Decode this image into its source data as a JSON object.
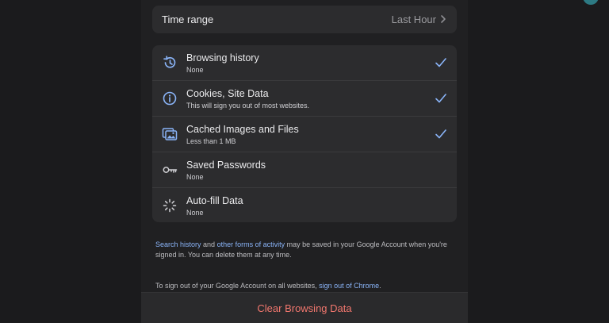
{
  "time_range": {
    "label": "Time range",
    "value": "Last Hour"
  },
  "options": [
    {
      "title": "Browsing history",
      "subtitle": "None",
      "icon": "history-icon",
      "checked": true
    },
    {
      "title": "Cookies, Site Data",
      "subtitle": "This will sign you out of most websites.",
      "icon": "info-icon",
      "checked": true
    },
    {
      "title": "Cached Images and Files",
      "subtitle": "Less than 1 MB",
      "icon": "images-icon",
      "checked": true
    },
    {
      "title": "Saved Passwords",
      "subtitle": "None",
      "icon": "key-icon",
      "checked": false
    },
    {
      "title": "Auto-fill Data",
      "subtitle": "None",
      "icon": "autofill-icon",
      "checked": false
    }
  ],
  "note1": {
    "link1": "Search history",
    "text1": " and ",
    "link2": "other forms of activity",
    "text2": " may be saved in your Google Account when you're signed in. You can delete them at any time."
  },
  "note2": {
    "text": "To sign out of your Google Account on all websites, ",
    "link": "sign out of Chrome",
    "end": "."
  },
  "footer": {
    "label": "Clear Browsing Data"
  },
  "colors": {
    "accent": "#8ab4f8",
    "destructive": "#f2776e",
    "check": "#8ab4f8"
  }
}
